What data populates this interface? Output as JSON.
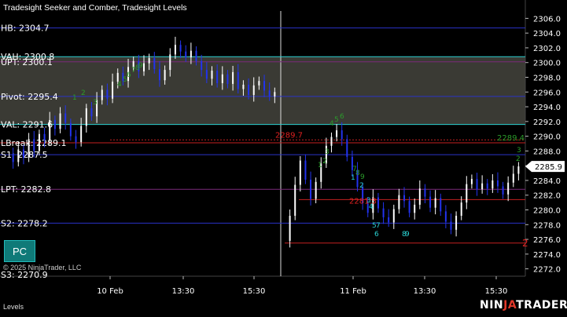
{
  "window": {
    "title": "Tradesight Seeker and Comber, Tradesight Levels",
    "copyright": "© 2025 NinjaTrader, LLC",
    "bottom_tab": "Levels",
    "brand_prefix": "NIN",
    "brand_suffix": "JA",
    "brand_rest": "TRADER",
    "pc_button_label": "PC"
  },
  "colors": {
    "background": "#000000",
    "candle_up": "#ffffff",
    "candle_down": "#2233ee",
    "level_line": "#2a33c8",
    "value_area_fill": "#3a3a34",
    "cyan_line": "#2ad1d1",
    "red_level": "#c42020",
    "green_marker": "#2b9b2b",
    "brand_red": "#e0382a"
  },
  "chart_data": {
    "type": "candlestick",
    "title": "Tradesight Seeker and Comber, Tradesight Levels",
    "xlabel": "",
    "ylabel": "",
    "ylim": [
      2271,
      2307
    ],
    "y_ticks": [
      "2306.0",
      "2304.0",
      "2302.0",
      "2300.0",
      "2298.0",
      "2296.0",
      "2294.0",
      "2292.0",
      "2290.0",
      "2288.0",
      "2286.0",
      "2284.0",
      "2282.0",
      "2280.0",
      "2278.0",
      "2276.0",
      "2274.0",
      "2272.0"
    ],
    "x_ticks": [
      "10 Feb",
      "13:30",
      "15:30",
      "11 Feb",
      "13:30",
      "15:30"
    ],
    "current_price": "2285.9",
    "levels": [
      {
        "label": "HB: 2304.7",
        "y": 2304.7,
        "kind": "blue"
      },
      {
        "label": "VAH: 2300.8",
        "y": 2300.8,
        "kind": "cyan"
      },
      {
        "label": "UPT: 2300.1",
        "y": 2300.1,
        "kind": "purple"
      },
      {
        "label": "Pivot: 2295.4",
        "y": 2295.4,
        "kind": "blue"
      },
      {
        "label": "VAL: 2291.6",
        "y": 2291.6,
        "kind": "cyan"
      },
      {
        "label": "LBreak: 2289.1",
        "y": 2289.1,
        "kind": "red"
      },
      {
        "label": "S1: 2287.5",
        "y": 2287.5,
        "kind": "blue"
      },
      {
        "label": "LPT: 2282.8",
        "y": 2282.8,
        "kind": "purple"
      },
      {
        "label": "S2: 2278.2",
        "y": 2278.2,
        "kind": "blue"
      },
      {
        "label": "S3: 2270.9",
        "y": 2270.9,
        "kind": "blue"
      }
    ],
    "value_area": [
      2291.6,
      2300.8
    ],
    "annotations": [
      {
        "text": "2289.7",
        "y": 2289.7,
        "color": "red"
      },
      {
        "text": "2289.4",
        "y": 2289.4,
        "color": "green"
      },
      {
        "text": "2281.3",
        "y": 2281.3,
        "color": "red"
      },
      {
        "text": "2",
        "y": 2275.5,
        "color": "red"
      }
    ],
    "seq_markers_green": [
      "1",
      "2",
      "3",
      "4",
      "5",
      "6",
      "7",
      "8",
      "9",
      "1",
      "2",
      "3",
      "4",
      "5",
      "6",
      "7",
      "8",
      "9",
      "2",
      "3"
    ],
    "seq_markers_cyan": [
      "1",
      "2",
      "3",
      "4",
      "5",
      "7",
      "6",
      "8",
      "9"
    ]
  }
}
